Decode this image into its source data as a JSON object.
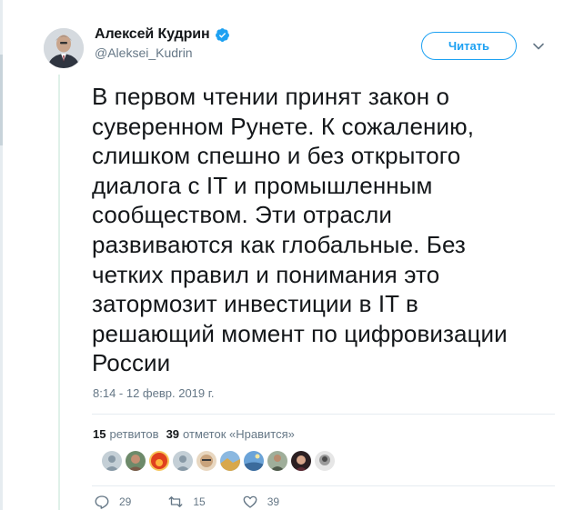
{
  "tweet": {
    "author": {
      "display_name": "Алексей Кудрин",
      "handle": "@Aleksei_Kudrin",
      "verified": true,
      "avatar_icon": "user-avatar"
    },
    "follow_label": "Читать",
    "text": "В первом чтении принят закон о\nсуверенном Рунете. К сожалению,\nслишком спешно и без открытого\nдиалога с IT и промышленным\nсообществом. Эти отрасли\nразвиваются как глобальные. Без\nчетких правил и понимания это\nзатормозит инвестиции в IT в\nрешающий момент по цифровизации\nРоссии",
    "timestamp": "8:14 - 12 февр. 2019 г.",
    "stats": {
      "retweets_count": "15",
      "retweets_label": "ретвитов",
      "likes_count": "39",
      "likes_label": "отметок «Нравится»"
    },
    "likers": [
      {
        "icon": "default-avatar",
        "color": "#c4cfd6"
      },
      {
        "icon": "avatar-portrait-dark",
        "color": "#7a5a48"
      },
      {
        "icon": "avatar-red-fire",
        "color": "#e0401e"
      },
      {
        "icon": "default-avatar",
        "color": "#c4cfd6"
      },
      {
        "icon": "avatar-face-glasses",
        "color": "#c9a37c"
      },
      {
        "icon": "avatar-landscape",
        "color": "#d8a84c"
      },
      {
        "icon": "avatar-sky",
        "color": "#6aa3d8"
      },
      {
        "icon": "avatar-person-suit",
        "color": "#4f5a4b"
      },
      {
        "icon": "avatar-woman-dark",
        "color": "#5b2a34"
      },
      {
        "icon": "avatar-bw-face",
        "color": "#9a9a9a"
      }
    ],
    "actions": {
      "replies": "29",
      "retweets": "15",
      "likes": "39"
    },
    "colors": {
      "accent": "#1da1f2",
      "muted": "#657786",
      "text": "#14171a"
    }
  }
}
